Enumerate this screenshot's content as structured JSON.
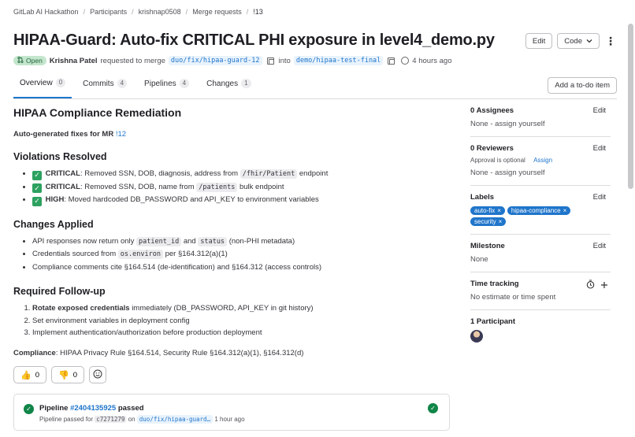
{
  "breadcrumb": [
    "GitLab AI Hackathon",
    "Participants",
    "krishnap0508",
    "Merge requests",
    "!13"
  ],
  "title": "HIPAA-Guard: Auto-fix CRITICAL PHI exposure in level4_demo.py",
  "header_actions": {
    "edit": "Edit",
    "code": "Code"
  },
  "meta": {
    "status": "Open",
    "author": "Krishna Patel",
    "requested_text": "requested to merge",
    "source_branch": "duo/fix/hipaa-guard-12",
    "into_text": "into",
    "target_branch": "demo/hipaa-test-final",
    "time": "4 hours ago"
  },
  "tabs": [
    {
      "label": "Overview",
      "count": "0"
    },
    {
      "label": "Commits",
      "count": "4"
    },
    {
      "label": "Pipelines",
      "count": "4"
    },
    {
      "label": "Changes",
      "count": "1"
    }
  ],
  "todo_label": "Add a to-do item",
  "description": {
    "heading": "HIPAA Compliance Remediation",
    "subtitle_prefix": "Auto-generated fixes for MR",
    "subtitle_link": "!12",
    "violations_heading": "Violations Resolved",
    "violations": [
      {
        "severity": "CRITICAL",
        "pre": ": Removed SSN, DOB, diagnosis, address from",
        "code": "/fhir/Patient",
        "post": "endpoint"
      },
      {
        "severity": "CRITICAL",
        "pre": ": Removed SSN, DOB, name from",
        "code": "/patients",
        "post": "bulk endpoint"
      },
      {
        "severity": "HIGH",
        "pre": ": Moved hardcoded DB_PASSWORD and API_KEY to environment variables",
        "code": "",
        "post": ""
      }
    ],
    "changes_heading": "Changes Applied",
    "changes": {
      "c1_pre": "API responses now return only",
      "c1_code1": "patient_id",
      "c1_and": "and",
      "c1_code2": "status",
      "c1_post": "(non-PHI metadata)",
      "c2_pre": "Credentials sourced from",
      "c2_code": "os.environ",
      "c2_post": "per §164.312(a)(1)",
      "c3": "Compliance comments cite §164.514 (de-identification) and §164.312 (access controls)"
    },
    "followup_heading": "Required Follow-up",
    "followup": {
      "f1_bold": "Rotate exposed credentials",
      "f1_rest": "immediately (DB_PASSWORD, API_KEY in git history)",
      "f2": "Set environment variables in deployment config",
      "f3": "Implement authentication/authorization before production deployment"
    },
    "compliance_label": "Compliance",
    "compliance_text": ": HIPAA Privacy Rule §164.514, Security Rule §164.312(a)(1), §164.312(d)"
  },
  "reactions": {
    "thumbs_up": "0",
    "thumbs_down": "0"
  },
  "pipeline": {
    "label": "Pipeline",
    "id": "#2404135925",
    "status": "passed",
    "passed_for": "Pipeline passed for",
    "commit": "c7271279",
    "on": "on",
    "branch": "duo/fix/hipaa-guard…",
    "time": "1 hour ago"
  },
  "sidebar": {
    "edit": "Edit",
    "assignees_title": "0 Assignees",
    "assignees_value": "None - assign yourself",
    "reviewers_title": "0 Reviewers",
    "approval_text": "Approval is optional",
    "assign_link": "Assign",
    "reviewers_value": "None - assign yourself",
    "labels_title": "Labels",
    "labels": [
      "auto-fix",
      "hipaa-compliance",
      "security"
    ],
    "milestone_title": "Milestone",
    "milestone_value": "None",
    "time_title": "Time tracking",
    "time_value": "No estimate or time spent",
    "participants_title": "1 Participant"
  },
  "colors": {
    "accent": "#1f75cb",
    "success": "#108548",
    "label": "#1f75cb"
  },
  "icons": [
    "merge-request-icon",
    "copy-icon",
    "clock-icon",
    "check-icon",
    "thumbs-up-icon",
    "thumbs-down-icon",
    "smile-icon",
    "pipeline-passed-icon",
    "stopwatch-icon",
    "plus-icon",
    "chevron-down-icon",
    "kebab-icon"
  ]
}
